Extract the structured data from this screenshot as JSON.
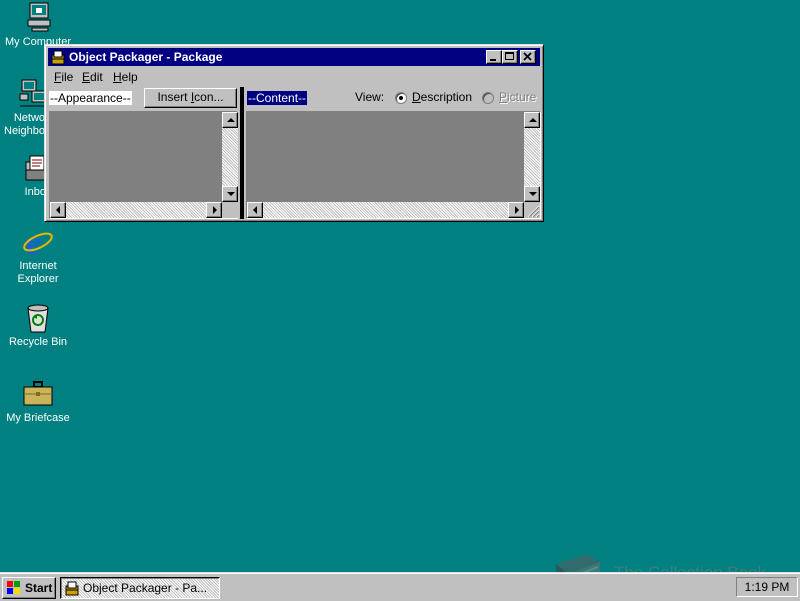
{
  "desktop": {
    "icons": [
      {
        "label": "My Computer"
      },
      {
        "label": "Network Neighborhood"
      },
      {
        "label": "Inbox"
      },
      {
        "label": "Internet Explorer"
      },
      {
        "label": "Recycle Bin"
      },
      {
        "label": "My Briefcase"
      }
    ]
  },
  "window": {
    "title": "Object Packager - Package",
    "menus": [
      {
        "label": "File",
        "accel": "F",
        "rest": "ile"
      },
      {
        "label": "Edit",
        "accel": "E",
        "rest": "dit"
      },
      {
        "label": "Help",
        "accel": "H",
        "rest": "elp"
      }
    ],
    "appearance_label": "--Appearance--",
    "insert_icon_button": {
      "accel": "I",
      "pre": "Insert ",
      "post": "con..."
    },
    "content_label": "--Content--",
    "view_label": "View:",
    "view_options": [
      {
        "label": "Description",
        "accel": "D",
        "rest": "escription",
        "selected": true
      },
      {
        "label": "Picture",
        "accel": "P",
        "rest": "icture",
        "selected": false,
        "disabled": true
      }
    ]
  },
  "taskbar": {
    "start_label": "Start",
    "task_label": "Object Packager - Pa...",
    "clock": "1:19 PM"
  },
  "watermark": {
    "text": "The Collection Book"
  },
  "colors": {
    "desktop": "#008080",
    "titlebar": "#000080",
    "face": "#c0c0c0",
    "selection": "#000080"
  }
}
